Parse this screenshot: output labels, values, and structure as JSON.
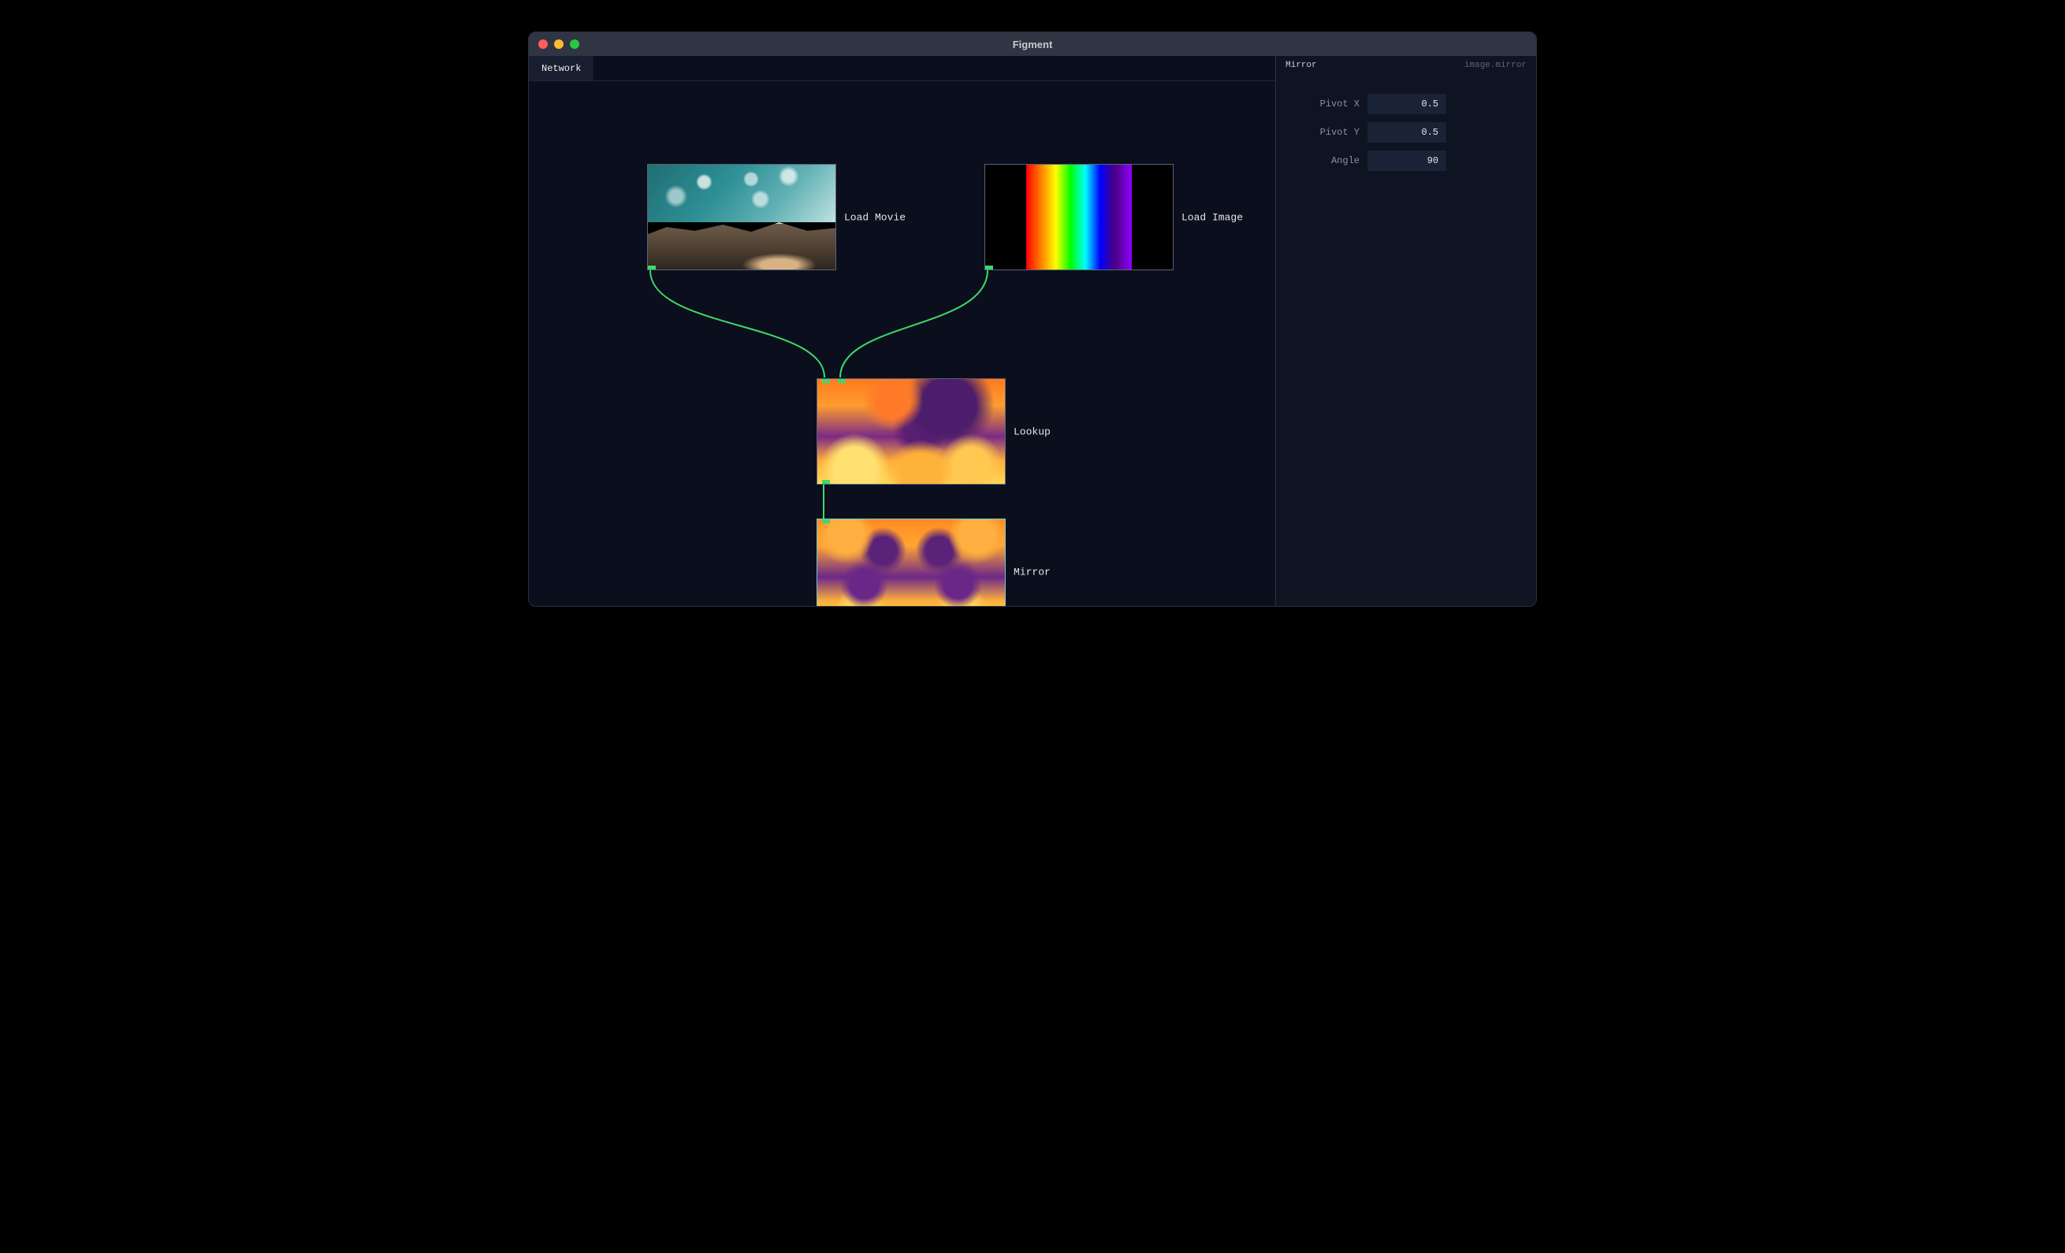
{
  "app": {
    "title": "Figment"
  },
  "tabs": [
    {
      "label": "Network"
    }
  ],
  "nodes": {
    "load_movie": {
      "label": "Load Movie"
    },
    "load_image": {
      "label": "Load Image"
    },
    "lookup": {
      "label": "Lookup"
    },
    "mirror": {
      "label": "Mirror"
    }
  },
  "inspector": {
    "node_name": "Mirror",
    "node_type": "image.mirror",
    "params": {
      "pivot_x": {
        "label": "Pivot X",
        "value": "0.5"
      },
      "pivot_y": {
        "label": "Pivot Y",
        "value": "0.5"
      },
      "angle": {
        "label": "Angle",
        "value": "90"
      }
    }
  },
  "colors": {
    "connection": "#3fd86b",
    "selection": "#6cc6d7"
  }
}
